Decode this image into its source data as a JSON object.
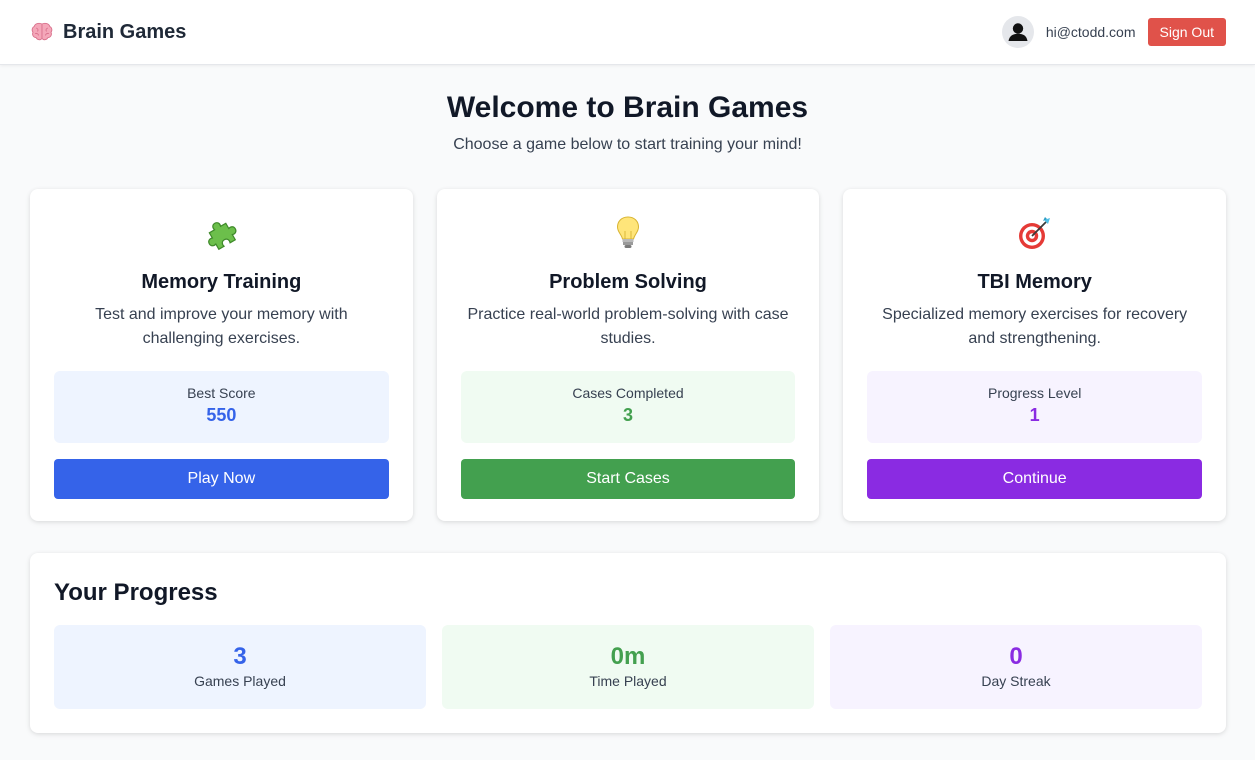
{
  "app": {
    "title": "Brain Games",
    "brand_icon": "brain-icon"
  },
  "user": {
    "email": "hi@ctodd.com",
    "avatar_icon": "user-icon",
    "signout_label": "Sign Out"
  },
  "hero": {
    "title": "Welcome to Brain Games",
    "subtitle": "Choose a game below to start training your mind!"
  },
  "games": [
    {
      "icon": "puzzle-piece-icon",
      "title": "Memory Training",
      "description": "Test and improve your memory with challenging exercises.",
      "stat_label": "Best Score",
      "stat_value": "550",
      "button_label": "Play Now",
      "accent": "#3563e9",
      "tint": "#eef4ff"
    },
    {
      "icon": "light-bulb-icon",
      "title": "Problem Solving",
      "description": "Practice real-world problem-solving with case studies.",
      "stat_label": "Cases Completed",
      "stat_value": "3",
      "button_label": "Start Cases",
      "accent": "#43a04f",
      "tint": "#f0fbf2"
    },
    {
      "icon": "target-dart-icon",
      "title": "TBI Memory",
      "description": "Specialized memory exercises for recovery and strengthening.",
      "stat_label": "Progress Level",
      "stat_value": "1",
      "button_label": "Continue",
      "accent": "#8a2be2",
      "tint": "#f7f3ff"
    }
  ],
  "progress": {
    "title": "Your Progress",
    "items": [
      {
        "value": "3",
        "label": "Games Played",
        "accent": "#3563e9",
        "tint": "#eef4ff"
      },
      {
        "value": "0m",
        "label": "Time Played",
        "accent": "#43a04f",
        "tint": "#f0fbf2"
      },
      {
        "value": "0",
        "label": "Day Streak",
        "accent": "#8a2be2",
        "tint": "#f7f3ff"
      }
    ]
  },
  "colors": {
    "signout": "#e0524a",
    "background": "#f9fafb"
  }
}
